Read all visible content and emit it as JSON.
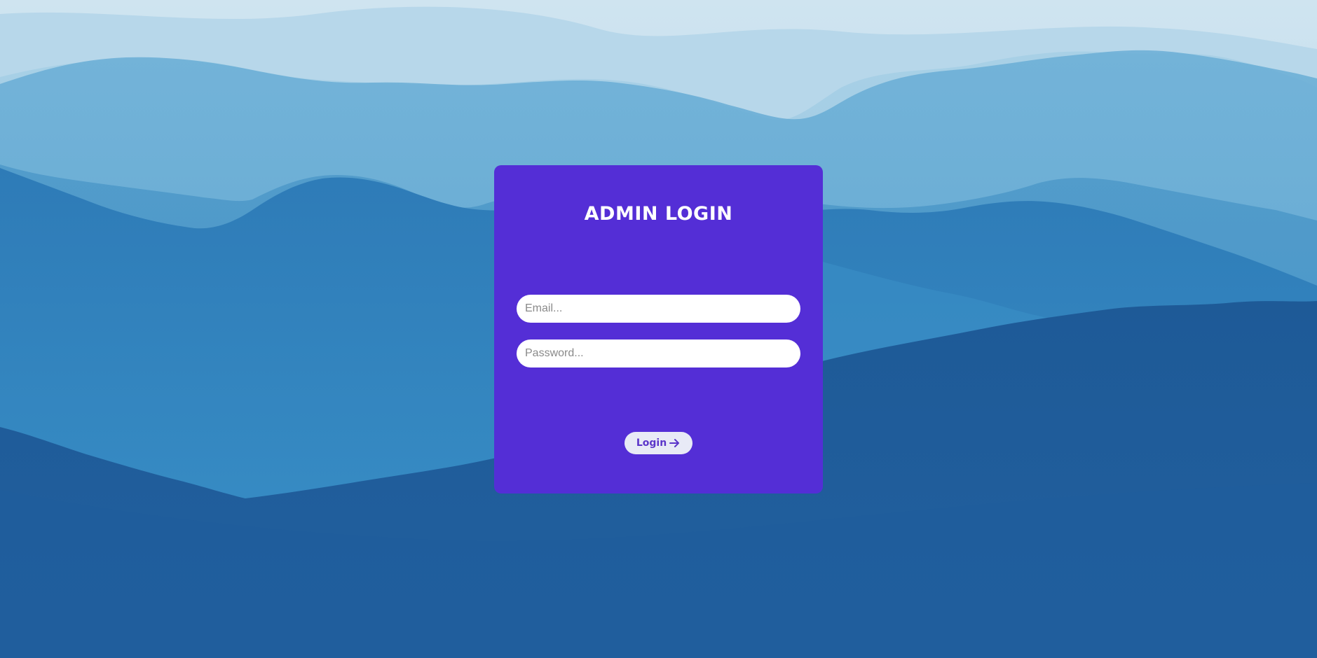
{
  "login": {
    "title": "ADMIN LOGIN",
    "email_placeholder": "Email...",
    "password_placeholder": "Password...",
    "button_label": "Login",
    "button_icon": "arrow-right-icon"
  },
  "colors": {
    "card_background": "#542ed6",
    "button_background": "#e8eaf6",
    "button_text": "#5b35c9",
    "title_text": "#ffffff",
    "sky": "#bcd9ea",
    "mountains_far": "#9fcbe4",
    "mountains_mid": "#5aa3cf",
    "mountains_near": "#2f7fb8",
    "forest_dark": "#1f5f9e"
  },
  "background": {
    "image": "misty blue mountain ridges"
  }
}
